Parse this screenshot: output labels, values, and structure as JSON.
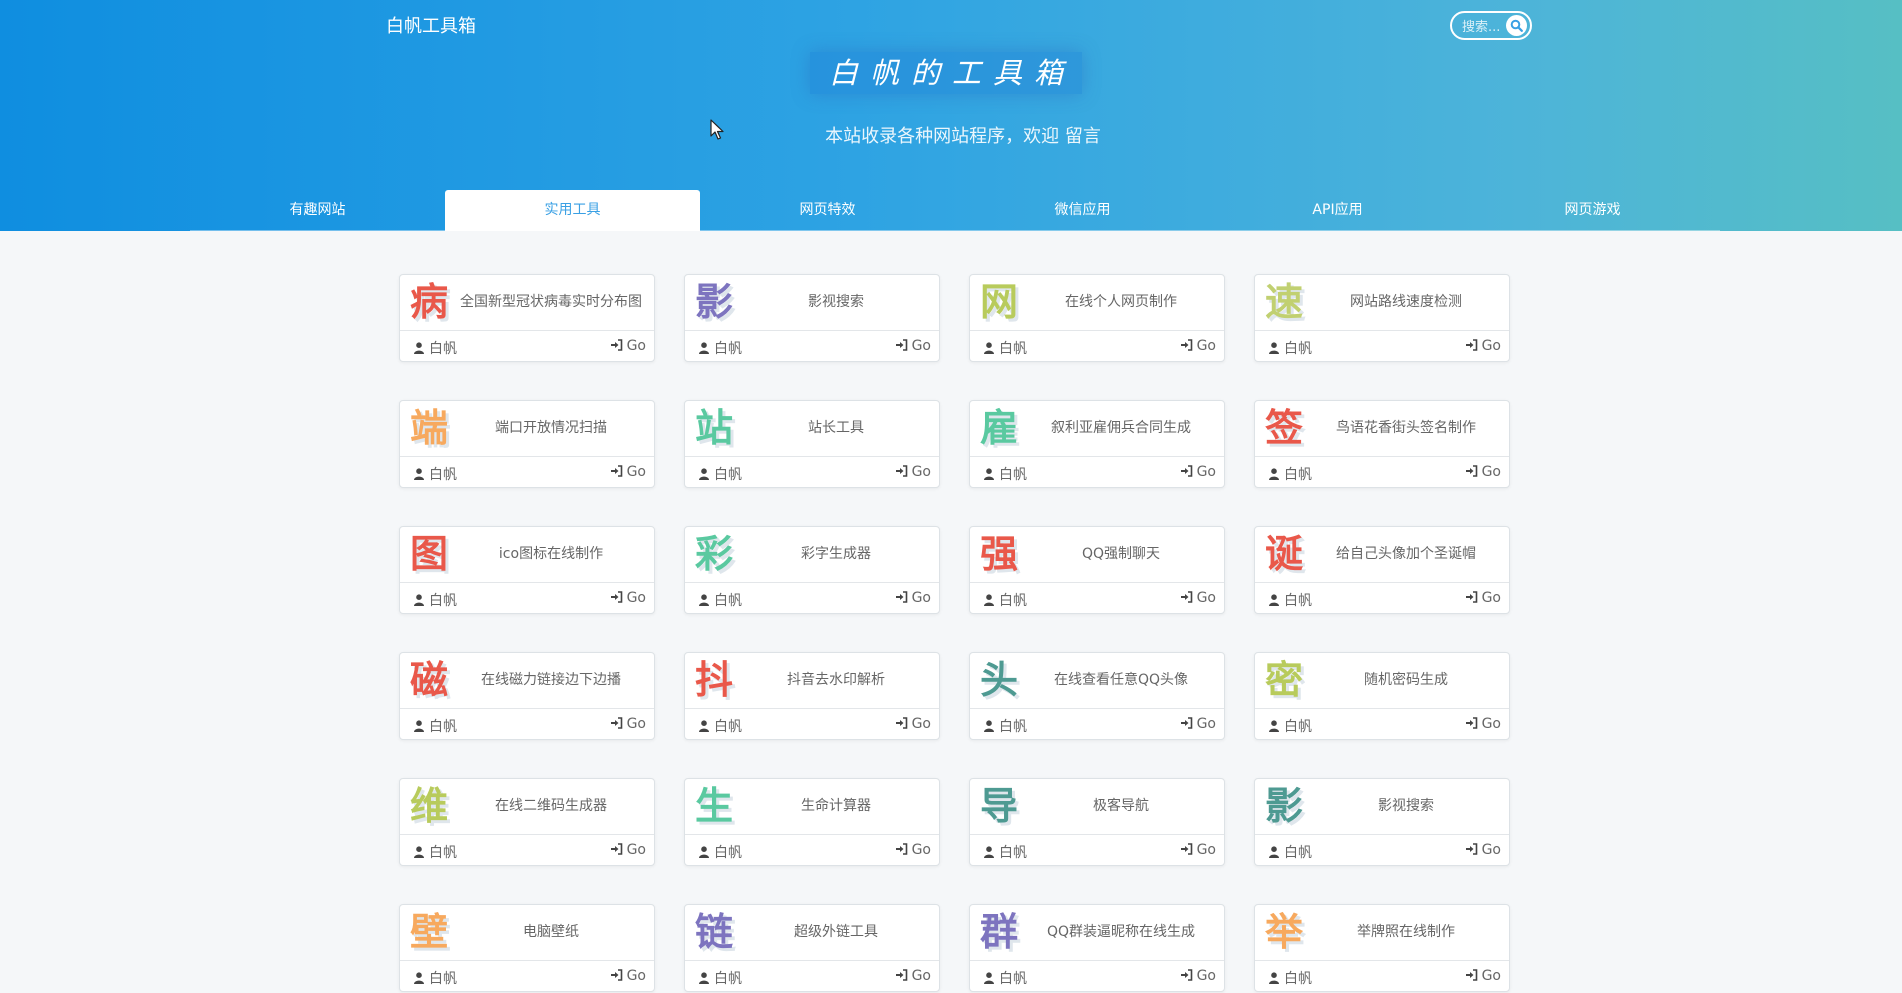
{
  "header": {
    "brand": "白帆工具箱",
    "title": "白帆的工具箱",
    "subtitle": "本站收录各种网站程序，欢迎 留言",
    "search_placeholder": "搜索..."
  },
  "nav": [
    {
      "label": "有趣网站",
      "active": false
    },
    {
      "label": "实用工具",
      "active": true
    },
    {
      "label": "网页特效",
      "active": false
    },
    {
      "label": "微信应用",
      "active": false
    },
    {
      "label": "API应用",
      "active": false
    },
    {
      "label": "网页游戏",
      "active": false
    }
  ],
  "cards": [
    {
      "badge": "病",
      "name": "全国新型冠状病毒实时分布图",
      "author": "白帆",
      "go": "Go",
      "color": "#e9584a"
    },
    {
      "badge": "影",
      "name": "影视搜索",
      "author": "白帆",
      "go": "Go",
      "color": "#7d74bf"
    },
    {
      "badge": "网",
      "name": "在线个人网页制作",
      "author": "白帆",
      "go": "Go",
      "color": "#b8cb5c"
    },
    {
      "badge": "速",
      "name": "网站路线速度检测",
      "author": "白帆",
      "go": "Go",
      "color": "#c1d071"
    },
    {
      "badge": "端",
      "name": "端口开放情况扫描",
      "author": "白帆",
      "go": "Go",
      "color": "#f7a95e"
    },
    {
      "badge": "站",
      "name": "站长工具",
      "author": "白帆",
      "go": "Go",
      "color": "#5ac9a0"
    },
    {
      "badge": "雇",
      "name": "叙利亚雇佣兵合同生成",
      "author": "白帆",
      "go": "Go",
      "color": "#5ac9a0"
    },
    {
      "badge": "签",
      "name": "鸟语花香街头签名制作",
      "author": "白帆",
      "go": "Go",
      "color": "#e9584a"
    },
    {
      "badge": "图",
      "name": "ico图标在线制作",
      "author": "白帆",
      "go": "Go",
      "color": "#e9584a"
    },
    {
      "badge": "彩",
      "name": "彩字生成器",
      "author": "白帆",
      "go": "Go",
      "color": "#5ac9a0"
    },
    {
      "badge": "强",
      "name": "QQ强制聊天",
      "author": "白帆",
      "go": "Go",
      "color": "#e9584a"
    },
    {
      "badge": "诞",
      "name": "给自己头像加个圣诞帽",
      "author": "白帆",
      "go": "Go",
      "color": "#e9584a"
    },
    {
      "badge": "磁",
      "name": "在线磁力链接边下边播",
      "author": "白帆",
      "go": "Go",
      "color": "#e9584a"
    },
    {
      "badge": "抖",
      "name": "抖音去水印解析",
      "author": "白帆",
      "go": "Go",
      "color": "#e9584a"
    },
    {
      "badge": "头",
      "name": "在线查看任意QQ头像",
      "author": "白帆",
      "go": "Go",
      "color": "#4e9a92"
    },
    {
      "badge": "密",
      "name": "随机密码生成",
      "author": "白帆",
      "go": "Go",
      "color": "#b8cb5c"
    },
    {
      "badge": "维",
      "name": "在线二维码生成器",
      "author": "白帆",
      "go": "Go",
      "color": "#b8cb5c"
    },
    {
      "badge": "生",
      "name": "生命计算器",
      "author": "白帆",
      "go": "Go",
      "color": "#5ac9a0"
    },
    {
      "badge": "导",
      "name": "极客导航",
      "author": "白帆",
      "go": "Go",
      "color": "#4e9a92"
    },
    {
      "badge": "影",
      "name": "影视搜索",
      "author": "白帆",
      "go": "Go",
      "color": "#4e9a92"
    },
    {
      "badge": "壁",
      "name": "电脑壁纸",
      "author": "白帆",
      "go": "Go",
      "color": "#f7a95e"
    },
    {
      "badge": "链",
      "name": "超级外链工具",
      "author": "白帆",
      "go": "Go",
      "color": "#7d74bf"
    },
    {
      "badge": "群",
      "name": "QQ群装逼昵称在线生成",
      "author": "白帆",
      "go": "Go",
      "color": "#7d74bf"
    },
    {
      "badge": "举",
      "name": "举牌照在线制作",
      "author": "白帆",
      "go": "Go",
      "color": "#f7a95e"
    }
  ]
}
